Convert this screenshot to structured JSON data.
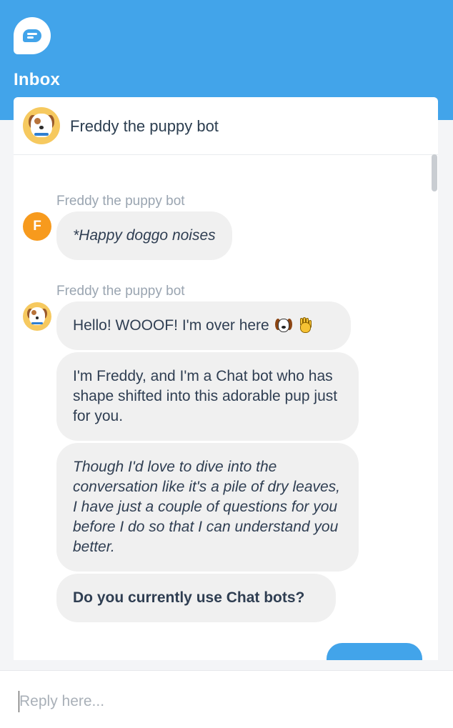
{
  "header": {
    "logo_icon": "chat-bubble-icon",
    "title": "Inbox",
    "accent_color": "#42a4ea"
  },
  "conversation": {
    "name": "Freddy the puppy bot",
    "avatar_icon": "puppy-avatar-icon"
  },
  "messages": [
    {
      "sender": "Freddy the puppy bot",
      "avatar_letter": "F",
      "bubbles": [
        "*Happy doggo noises"
      ]
    },
    {
      "sender": "Freddy the puppy bot",
      "avatar_icon": "puppy-avatar-icon",
      "bubbles": [
        "Hello! WOOOF! I'm over here",
        "I'm Freddy, and I'm a Chat bot who has shape shifted into this adorable pup just for you.",
        "Though I'd love to dive into the conversation like it's a pile of dry leaves, I have just a couple of questions for you before I do so that I can understand you better.",
        "Do you currently use Chat bots?"
      ],
      "emoji_icons": [
        "dog-face-emoji-icon",
        "waving-hand-emoji-icon"
      ]
    }
  ],
  "reply": {
    "placeholder": "Reply here..."
  }
}
